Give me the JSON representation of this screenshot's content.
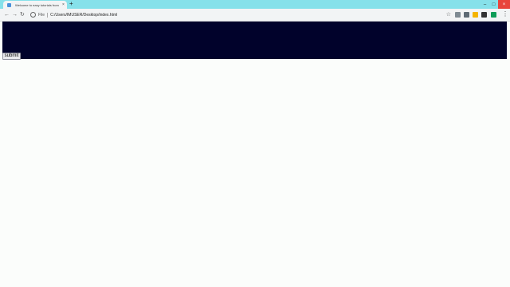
{
  "browser": {
    "tab_title": "Welcome to easy tutorials from",
    "tab_close": "×",
    "new_tab": "+",
    "url_scheme": "File",
    "url": "C:/Users/IMUSER/Desktop/index.html",
    "window_controls": {
      "minimize": "–",
      "maximize": "□",
      "close": "×"
    },
    "toolbar_icons": [
      "back-icon",
      "forward-icon",
      "reload-icon",
      "star-icon",
      "extension-icon",
      "menu-icon"
    ],
    "colors": {
      "tabstrip": "#86e1ea",
      "toolbar": "#f2f4f5",
      "close_button": "#e8453c"
    }
  },
  "page": {
    "header_bg": "#01022b",
    "heading": "",
    "paragraph": "",
    "submit_label": "submit",
    "background": "#fbfdfb"
  }
}
